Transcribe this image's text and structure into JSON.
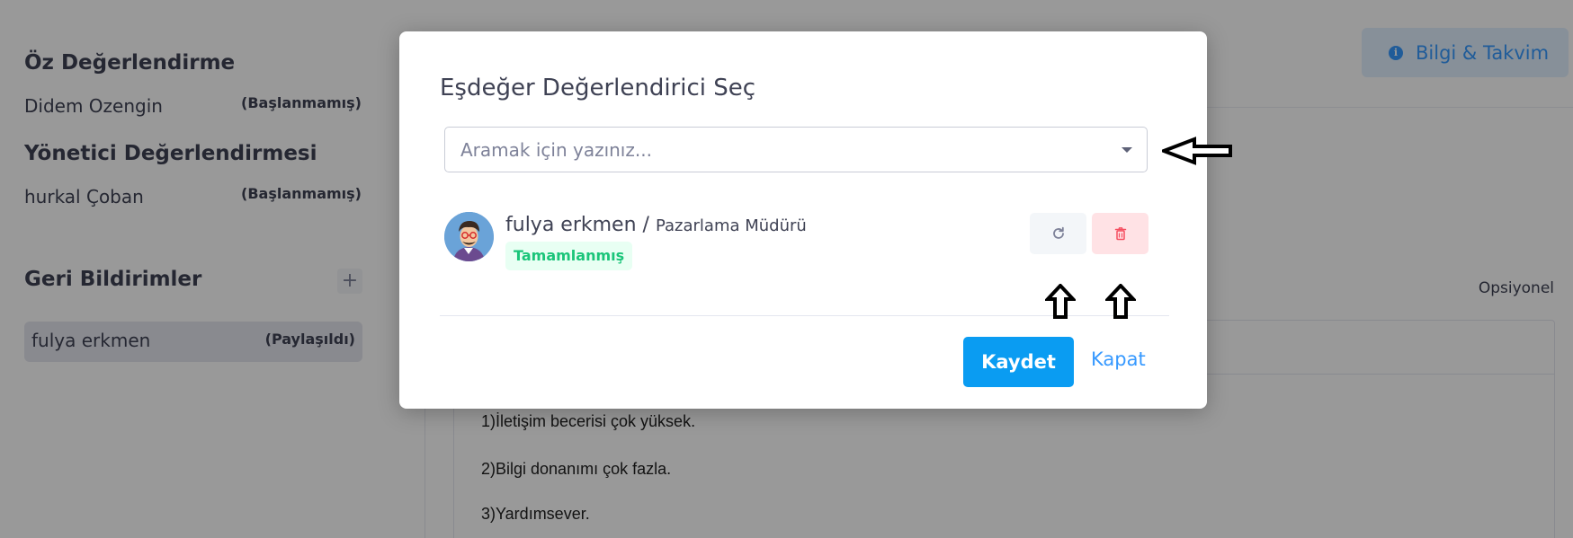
{
  "sidebar": {
    "self_eval": {
      "title": "Öz Değerlendirme",
      "name": "Didem Ozengin",
      "status": "(Başlanmamış)"
    },
    "manager_eval": {
      "title": "Yönetici Değerlendirmesi",
      "name": "hurkal Çoban",
      "status": "(Başlanmamış)"
    },
    "feedback": {
      "title": "Geri Bildirimler",
      "add_symbol": "+",
      "items": [
        {
          "name": "fulya erkmen",
          "status": "(Paylaşıldı)"
        }
      ]
    }
  },
  "main": {
    "info_button_label": "Bilgi & Takvim",
    "info_icon_glyph": "i",
    "optional_label": "Opsiyonel",
    "answers": [
      "1)İletişim becerisi çok yüksek.",
      "2)Bilgi donanımı çok fazla.",
      "3)Yardımsever."
    ]
  },
  "modal": {
    "title": "Eşdeğer Değerlendirici Seç",
    "search_placeholder": "Aramak için yazınız...",
    "evaluator": {
      "name": "fulya erkmen",
      "separator": "/",
      "role": "Pazarlama Müdürü",
      "status": "Tamamlanmış"
    },
    "save_label": "Kaydet",
    "close_label": "Kapat"
  },
  "colors": {
    "primary": "#0a9cf2",
    "link": "#3699ff",
    "success": "#1bc57a",
    "danger": "#f64e60"
  },
  "icons": [
    "info-icon",
    "caret-down-icon",
    "refresh-icon",
    "trash-icon",
    "plus-icon",
    "avatar-icon"
  ]
}
